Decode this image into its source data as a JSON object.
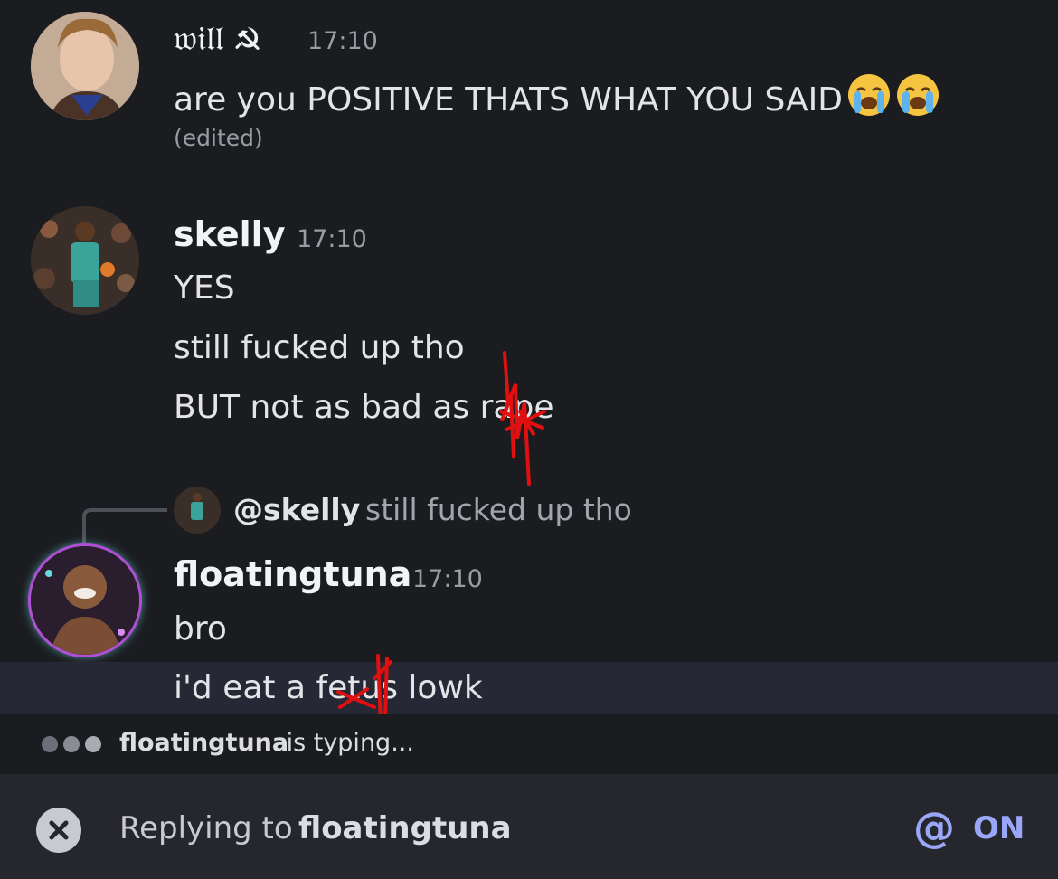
{
  "messages": [
    {
      "username": "𝔴𝔦𝔩𝔩 ☭",
      "timestamp": "17:10",
      "lines": [
        "are you POSITIVE THATS WHAT YOU SAID"
      ],
      "emojis": [
        "loudly-crying-face",
        "loudly-crying-face"
      ],
      "edited_label": "(edited)"
    },
    {
      "username": "skelly",
      "timestamp": "17:10",
      "lines": [
        "YES",
        "still fucked up tho",
        "BUT not as bad as rape"
      ]
    },
    {
      "reply_preview": {
        "mention": "@skelly",
        "text": "still fucked up tho"
      },
      "username": "floatingtuna",
      "timestamp": "17:10",
      "lines": [
        "bro",
        "i'd eat a fetus lowk"
      ]
    }
  ],
  "typing": {
    "user": "floatingtuna",
    "suffix": " is typing..."
  },
  "reply_bar": {
    "prefix": "Replying to ",
    "target": "floatingtuna",
    "mention_icon": "@",
    "mention_state": "ON"
  },
  "colors": {
    "background": "#1b1c20",
    "highlight_row": "#262835",
    "reply_bar": "#26272c",
    "accent": "#9aa6f7",
    "redaction": "#e01010"
  }
}
